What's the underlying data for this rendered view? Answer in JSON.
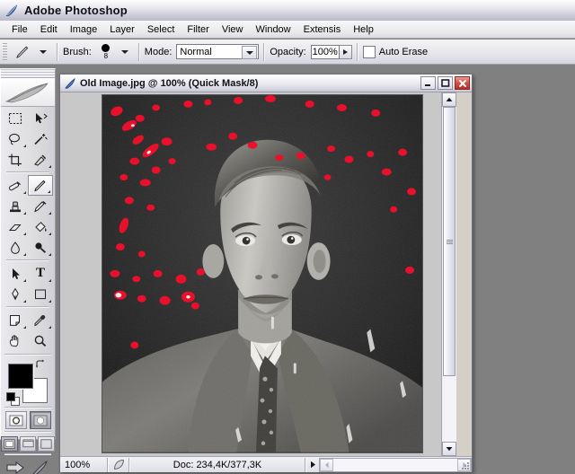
{
  "app": {
    "title": "Adobe Photoshop",
    "icon": "photoshop-feather-icon"
  },
  "menubar": {
    "items": [
      {
        "label": "File",
        "mnemonic": "F"
      },
      {
        "label": "Edit",
        "mnemonic": "E"
      },
      {
        "label": "Image",
        "mnemonic": "I"
      },
      {
        "label": "Layer",
        "mnemonic": "L"
      },
      {
        "label": "Select",
        "mnemonic": "S"
      },
      {
        "label": "Filter",
        "mnemonic": "t"
      },
      {
        "label": "View",
        "mnemonic": "V"
      },
      {
        "label": "Window",
        "mnemonic": "W"
      },
      {
        "label": "Extensis",
        "mnemonic": "x"
      },
      {
        "label": "Help",
        "mnemonic": "H"
      }
    ]
  },
  "options_bar": {
    "active_tool": "pencil-tool",
    "brush_label": "Brush:",
    "brush_size": "8",
    "mode_label": "Mode:",
    "mode_value": "Normal",
    "opacity_label": "Opacity:",
    "opacity_value": "100%",
    "auto_erase_label": "Auto Erase",
    "auto_erase_checked": false
  },
  "toolbox": {
    "tools": [
      {
        "name": "rectangular-marquee-tool",
        "glyph": "marquee",
        "selected": false,
        "has_flyout": false
      },
      {
        "name": "move-tool",
        "glyph": "move",
        "selected": false,
        "has_flyout": false
      },
      {
        "name": "lasso-tool",
        "glyph": "lasso",
        "selected": false,
        "has_flyout": true
      },
      {
        "name": "magic-wand-tool",
        "glyph": "wand",
        "selected": false,
        "has_flyout": false
      },
      {
        "name": "crop-tool",
        "glyph": "crop",
        "selected": false,
        "has_flyout": false
      },
      {
        "name": "slice-tool",
        "glyph": "slice",
        "selected": false,
        "has_flyout": true
      },
      {
        "name": "healing-brush-tool",
        "glyph": "healing",
        "selected": false,
        "has_flyout": true
      },
      {
        "name": "pencil-tool",
        "glyph": "pencil",
        "selected": true,
        "has_flyout": true
      },
      {
        "name": "clone-stamp-tool",
        "glyph": "stamp",
        "selected": false,
        "has_flyout": true
      },
      {
        "name": "history-brush-tool",
        "glyph": "historybrush",
        "selected": false,
        "has_flyout": true
      },
      {
        "name": "eraser-tool",
        "glyph": "eraser",
        "selected": false,
        "has_flyout": true
      },
      {
        "name": "paint-bucket-tool",
        "glyph": "bucket",
        "selected": false,
        "has_flyout": true
      },
      {
        "name": "blur-tool",
        "glyph": "blur",
        "selected": false,
        "has_flyout": true
      },
      {
        "name": "dodge-tool",
        "glyph": "dodge",
        "selected": false,
        "has_flyout": true
      },
      {
        "name": "path-selection-tool",
        "glyph": "arrow",
        "selected": false,
        "has_flyout": true
      },
      {
        "name": "type-tool",
        "glyph": "type",
        "selected": false,
        "has_flyout": true
      },
      {
        "name": "pen-tool",
        "glyph": "pen",
        "selected": false,
        "has_flyout": true
      },
      {
        "name": "rectangle-shape-tool",
        "glyph": "shape",
        "selected": false,
        "has_flyout": true
      },
      {
        "name": "notes-tool",
        "glyph": "notes",
        "selected": false,
        "has_flyout": true
      },
      {
        "name": "eyedropper-tool",
        "glyph": "eyedropper",
        "selected": false,
        "has_flyout": true
      },
      {
        "name": "hand-tool",
        "glyph": "hand",
        "selected": false,
        "has_flyout": false
      },
      {
        "name": "zoom-tool",
        "glyph": "zoom",
        "selected": false,
        "has_flyout": false
      }
    ],
    "foreground_color": "#000000",
    "background_color": "#ffffff",
    "quick_mask": {
      "standard_label": "standard-mode",
      "quickmask_label": "quick-mask-mode",
      "active": "quick-mask-mode"
    },
    "screen_modes": {
      "active": "standard-screen-mode",
      "modes": [
        "standard-screen-mode",
        "full-screen-with-menubar",
        "full-screen-mode"
      ]
    },
    "jump_to": [
      "jump-to-imageready",
      "edit-in-imageready"
    ]
  },
  "document": {
    "title": "Old Image.jpg @ 100% (Quick Mask/8)",
    "filename": "Old Image.jpg",
    "zoom": "100%",
    "mode": "Quick Mask/8",
    "window_buttons": {
      "minimize": "minimize-button",
      "maximize": "maximize-button",
      "close": "close-button"
    },
    "status": {
      "zoom_value": "100%",
      "doc_info": "Doc: 234,4K/377,3K"
    },
    "photo": {
      "description": "vintage black and white portrait photograph of a young man in a suit and tie with red quick-mask spots overlaid",
      "mask_color": "#e8102a"
    }
  }
}
